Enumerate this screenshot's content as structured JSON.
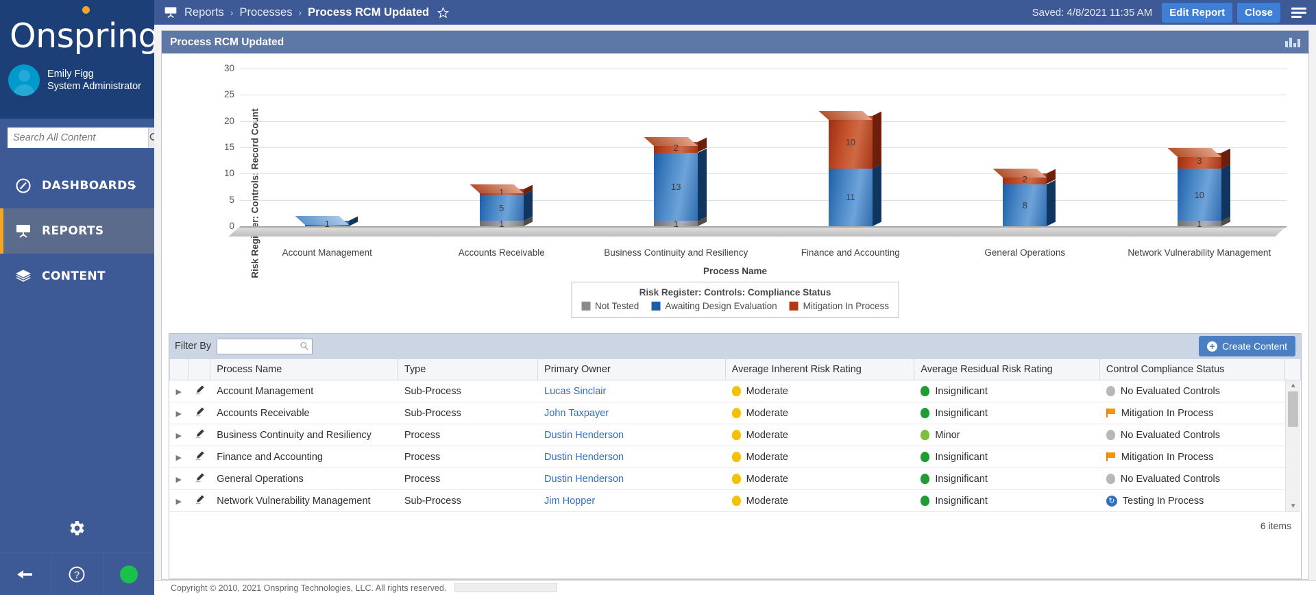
{
  "brand": {
    "name": "Onspring"
  },
  "user": {
    "name": "Emily Figg",
    "role": "System Administrator",
    "avatar_icon": "user-avatar-icon"
  },
  "search": {
    "placeholder": "Search All Content",
    "value": "",
    "icon": "search-icon"
  },
  "sidebar": {
    "items": [
      {
        "label": "DASHBOARDS",
        "icon": "dashboard-gauge-icon",
        "active": false,
        "has_chevron": true
      },
      {
        "label": "REPORTS",
        "icon": "report-presentation-icon",
        "active": true,
        "has_chevron": false
      },
      {
        "label": "CONTENT",
        "icon": "content-layers-icon",
        "active": false,
        "has_chevron": false
      }
    ],
    "gear_icon": "gear-icon",
    "bottom": [
      {
        "icon": "back-arrow-icon"
      },
      {
        "icon": "help-question-icon"
      },
      {
        "icon": "status-online-dot-icon"
      }
    ]
  },
  "topbar": {
    "breadcrumb_icon": "report-presentation-icon",
    "crumbs": [
      "Reports",
      "Processes",
      "Process RCM Updated"
    ],
    "separator": "›",
    "pin_icon": "pin-star-icon",
    "saved_text": "Saved: 4/8/2021 11:35 AM",
    "edit_label": "Edit Report",
    "close_label": "Close",
    "menu_icon": "hamburger-menu-icon"
  },
  "panel": {
    "title": "Process RCM Updated",
    "chart_toggle_icon": "chart-bars-icon"
  },
  "chart_data": {
    "type": "bar",
    "stacked": true,
    "title": "",
    "xlabel": "Process Name",
    "ylabel": "Risk Register: Controls: Record Count",
    "ylim": [
      0,
      30
    ],
    "yticks": [
      30,
      25,
      20,
      15,
      10,
      5,
      0
    ],
    "grid": true,
    "legend_position": "bottom",
    "legend_title": "Risk Register: Controls: Compliance Status",
    "categories": [
      "Account Management",
      "Accounts Receivable",
      "Business Continuity and Resiliency",
      "Finance and Accounting",
      "General Operations",
      "Network Vulnerability Management"
    ],
    "series": [
      {
        "name": "Not Tested",
        "color": "#8a8a8a",
        "values": [
          0,
          1,
          1,
          0,
          0,
          1
        ]
      },
      {
        "name": "Awaiting Design Evaluation",
        "color": "#1d5ea8",
        "values": [
          1,
          5,
          13,
          11,
          8,
          10
        ]
      },
      {
        "name": "Mitigation In Process",
        "color": "#b03a16",
        "values": [
          0,
          1,
          2,
          10,
          2,
          3
        ]
      }
    ],
    "totals": [
      1,
      7,
      16,
      21,
      10,
      14
    ]
  },
  "grid": {
    "filter_label": "Filter By",
    "filter_value": "",
    "filter_placeholder": "",
    "filter_icon": "search-icon",
    "create_label": "Create Content",
    "create_icon": "plus-circle-icon",
    "columns": [
      "Process Name",
      "Type",
      "Primary Owner",
      "Average Inherent Risk Rating",
      "Average Residual Risk Rating",
      "Control Compliance Status"
    ],
    "row_expand_icon": "chevron-right-icon",
    "row_edit_icon": "pencil-edit-icon",
    "rows": [
      {
        "name": "Account Management",
        "type": "Sub-Process",
        "owner": "Lucas Sinclair",
        "inherent": "Moderate",
        "inherent_dot": "yellow",
        "residual": "Insignificant",
        "residual_dot": "green",
        "status": "No Evaluated Controls",
        "status_icon": "gray-bulb-icon"
      },
      {
        "name": "Accounts Receivable",
        "type": "Sub-Process",
        "owner": "John Taxpayer",
        "inherent": "Moderate",
        "inherent_dot": "yellow",
        "residual": "Insignificant",
        "residual_dot": "green",
        "status": "Mitigation In Process",
        "status_icon": "orange-flag-icon"
      },
      {
        "name": "Business Continuity and Resiliency",
        "type": "Process",
        "owner": "Dustin Henderson",
        "inherent": "Moderate",
        "inherent_dot": "yellow",
        "residual": "Minor",
        "residual_dot": "lightgreen",
        "status": "No Evaluated Controls",
        "status_icon": "gray-bulb-icon"
      },
      {
        "name": "Finance and Accounting",
        "type": "Process",
        "owner": "Dustin Henderson",
        "inherent": "Moderate",
        "inherent_dot": "yellow",
        "residual": "Insignificant",
        "residual_dot": "green",
        "status": "Mitigation In Process",
        "status_icon": "orange-flag-icon"
      },
      {
        "name": "General Operations",
        "type": "Process",
        "owner": "Dustin Henderson",
        "inherent": "Moderate",
        "inherent_dot": "yellow",
        "residual": "Insignificant",
        "residual_dot": "green",
        "status": "No Evaluated Controls",
        "status_icon": "gray-bulb-icon"
      },
      {
        "name": "Network Vulnerability Management",
        "type": "Sub-Process",
        "owner": "Jim Hopper",
        "inherent": "Moderate",
        "inherent_dot": "yellow",
        "residual": "Insignificant",
        "residual_dot": "green",
        "status": "Testing In Process",
        "status_icon": "blue-refresh-icon"
      }
    ],
    "items_count": "6 items"
  },
  "footer": {
    "text": "Copyright © 2010, 2021 Onspring Technologies, LLC. All rights reserved."
  },
  "colors": {
    "brand_dark": "#1d3f78",
    "brand": "#3d5a96",
    "accent_orange": "#f5a623",
    "accent_blue": "#3f7fd8",
    "series_gray": "#8a8a8a",
    "series_blue": "#1d5ea8",
    "series_red": "#b03a16"
  }
}
